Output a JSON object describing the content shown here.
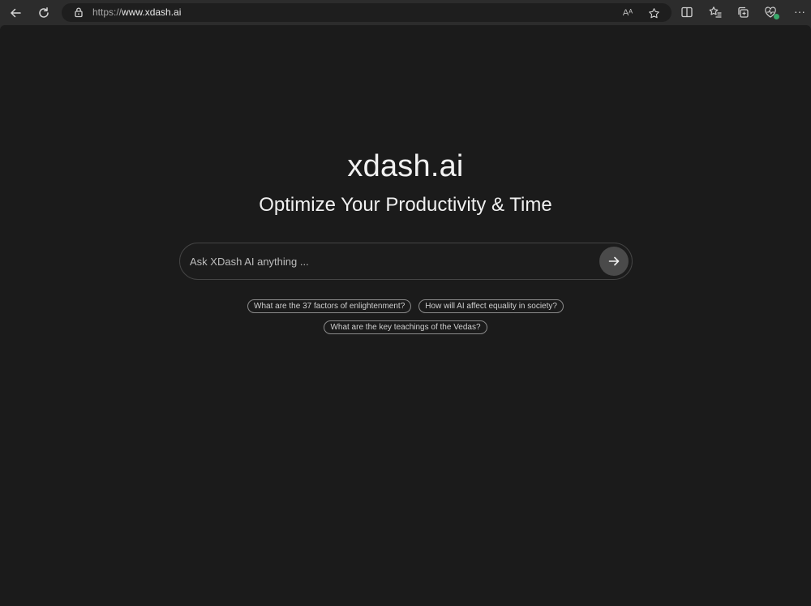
{
  "browser": {
    "url_protocol": "https://",
    "url_host": "www.xdash.ai",
    "read_aloud_label": "Aᴬ",
    "more_label": "···"
  },
  "page": {
    "brand": "xdash.ai",
    "tagline": "Optimize Your Productivity & Time"
  },
  "search": {
    "placeholder": "Ask XDash AI anything ..."
  },
  "suggestions": [
    [
      "What are the 37 factors of enlightenment?",
      "How will AI affect equality in society?"
    ],
    [
      "What are the key teachings of the Vedas?"
    ]
  ],
  "colors": {
    "background": "#1b1b1b",
    "chrome": "#2c2c2c",
    "text": "#f2f2f2",
    "status_dot": "#3aa96b"
  }
}
